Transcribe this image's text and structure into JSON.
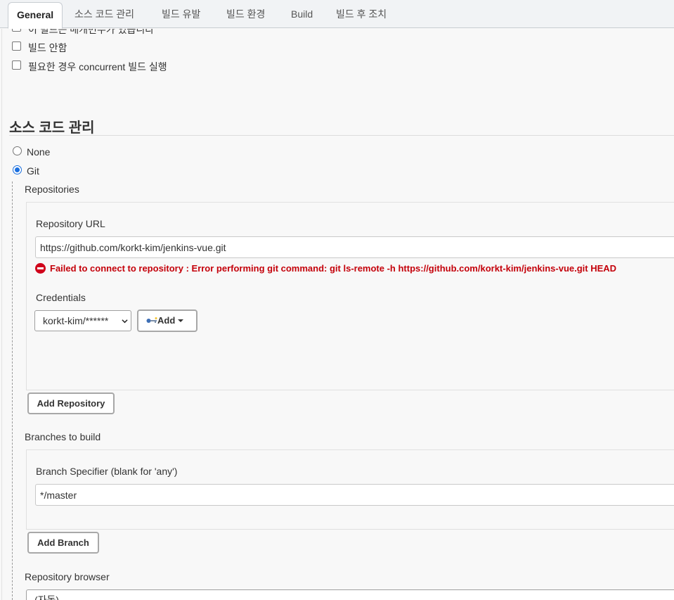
{
  "tabs": [
    {
      "label": "General",
      "active": true
    },
    {
      "label": "소스 코드 관리"
    },
    {
      "label": "빌드 유발"
    },
    {
      "label": "빌드 환경"
    },
    {
      "label": "Build"
    },
    {
      "label": "빌드 후 조치"
    }
  ],
  "general": {
    "options": [
      {
        "label": "이 빌드는 매개변수가 있습니다",
        "checked": false
      },
      {
        "label": "빌드 안함",
        "checked": false
      },
      {
        "label": "필요한 경우 concurrent 빌드 실행",
        "checked": false
      }
    ]
  },
  "scm": {
    "title": "소스 코드 관리",
    "options": [
      {
        "label": "None",
        "selected": false
      },
      {
        "label": "Git",
        "selected": true
      }
    ],
    "repositories_label": "Repositories",
    "repository_url_label": "Repository URL",
    "repository_url_value": "https://github.com/korkt-kim/jenkins-vue.git",
    "error_message": "Failed to connect to repository : Error performing git command: git ls-remote -h https://github.com/korkt-kim/jenkins-vue.git HEAD",
    "credentials_label": "Credentials",
    "credentials_selected": "korkt-kim/******",
    "add_button": "Add",
    "add_repository_button": "Add Repository",
    "branches_label": "Branches to build",
    "branch_specifier_label": "Branch Specifier (blank for 'any')",
    "branch_specifier_value": "*/master",
    "add_branch_button": "Add Branch",
    "repository_browser_label": "Repository browser",
    "repository_browser_value": "(자동)"
  },
  "colors": {
    "error": "#c4000a",
    "radio_accent": "#1a6fdf"
  }
}
